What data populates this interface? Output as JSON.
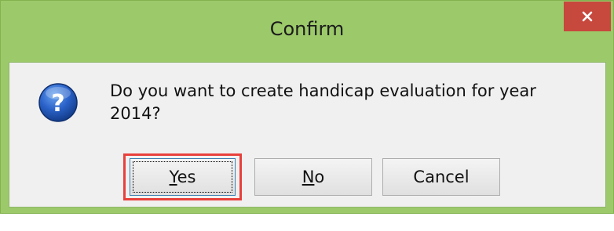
{
  "window": {
    "title": "Confirm",
    "close_icon": "close-icon",
    "accent_color": "#9cc96a",
    "close_color": "#c7483d"
  },
  "dialog": {
    "icon": "question-icon",
    "message": "Do you want to create handicap evaluation for year 2014?"
  },
  "buttons": {
    "yes": {
      "mnemonic": "Y",
      "rest": "es",
      "focused": true
    },
    "no": {
      "mnemonic": "N",
      "rest": "o"
    },
    "cancel": {
      "label": "Cancel"
    }
  },
  "highlight_color": "#e8403b"
}
